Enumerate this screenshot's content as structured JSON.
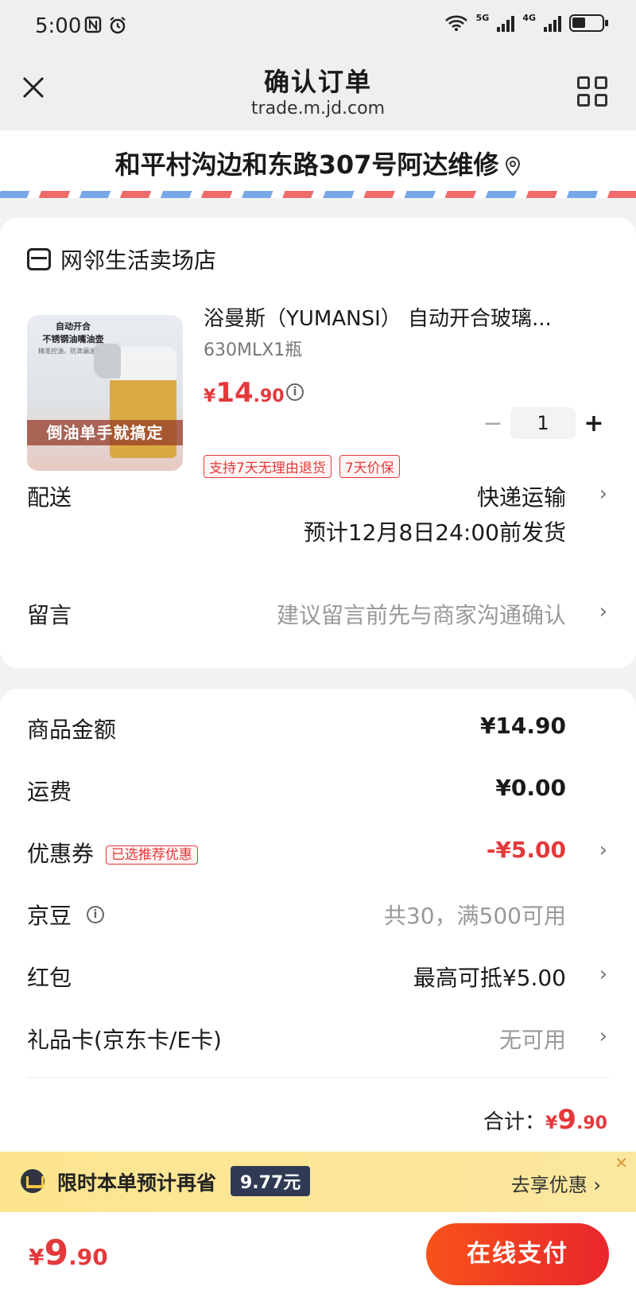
{
  "status_bar": {
    "time": "5:00",
    "net1": "5G",
    "net2": "4G"
  },
  "nav": {
    "title": "确认订单",
    "url": "trade.m.jd.com"
  },
  "address": {
    "text": "和平村沟边和东路307号阿达维修"
  },
  "store": {
    "name": "网邻生活卖场店"
  },
  "product": {
    "image_text_1": "自动开合",
    "image_text_2": "不锈钢油嘴油壶",
    "image_text_3": "精准控油，防滴漏油",
    "image_banner": "倒油单手就搞定",
    "name": "浴曼斯（YUMANSI） 自动开合玻璃...",
    "spec": "630MLX1瓶",
    "price_symbol": "¥",
    "price_int": "14",
    "price_dec": ".90",
    "quantity": "1",
    "tags": [
      "支持7天无理由退货",
      "7天价保"
    ]
  },
  "delivery": {
    "label": "配送",
    "method": "快递运输",
    "eta": "预计12月8日24:00前发货"
  },
  "message": {
    "label": "留言",
    "placeholder": "建议留言前先与商家沟通确认"
  },
  "summary": {
    "goods_label": "商品金额",
    "goods_value": "¥14.90",
    "shipping_label": "运费",
    "shipping_value": "¥0.00",
    "coupon_label": "优惠券",
    "coupon_tag": "已选推荐优惠",
    "coupon_value": "-¥5.00",
    "jingdou_label": "京豆",
    "jingdou_value": "共30，满500可用",
    "hongbao_label": "红包",
    "hongbao_value": "最高可抵¥5.00",
    "giftcard_label": "礼品卡(京东卡/E卡)",
    "giftcard_value": "无可用",
    "total_label": "合计：",
    "total_symbol": "¥",
    "total_int": "9",
    "total_dec": ".90"
  },
  "promo": {
    "text": "限时本单预计再省",
    "amount": "9.77元",
    "action": "去享优惠",
    "close": "✕"
  },
  "bottom": {
    "symbol": "¥",
    "int": "9",
    "dec": ".90",
    "pay_label": "在线支付"
  },
  "colors": {
    "accent_red": "#e4393c",
    "promo_bg": "#fde58f",
    "pay_gradient_start": "#f8521a"
  }
}
